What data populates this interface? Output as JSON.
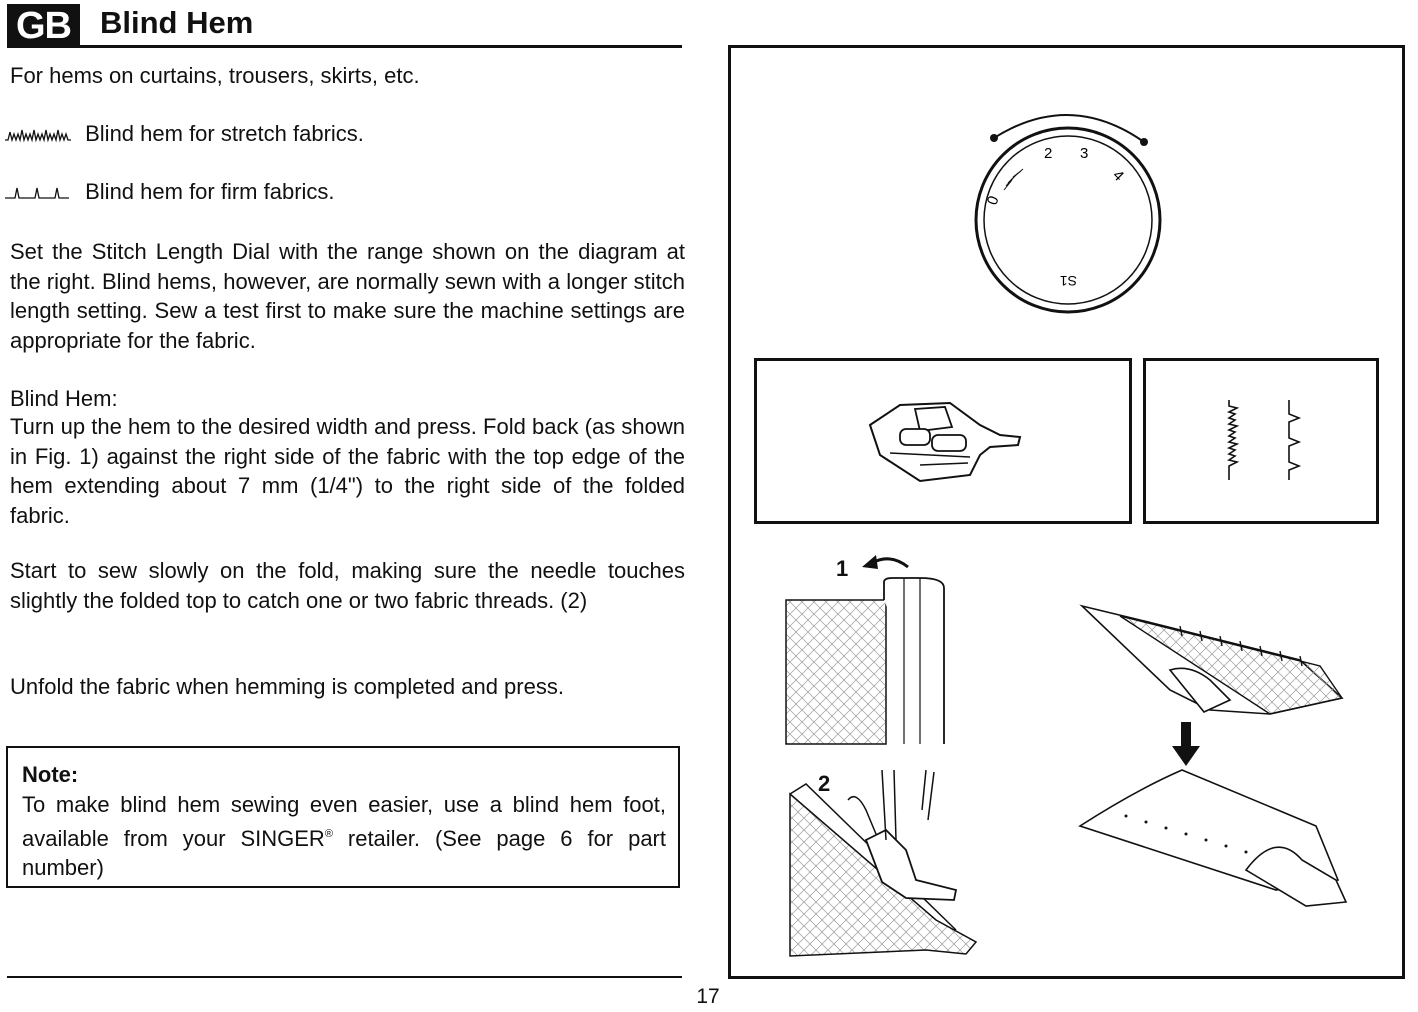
{
  "header": {
    "badge": "GB",
    "title": "Blind Hem"
  },
  "intro": "For hems on curtains, trousers, skirts, etc.",
  "stitches": [
    {
      "icon": "stretch-blind-stitch-icon",
      "label": "Blind hem for stretch fabrics."
    },
    {
      "icon": "firm-blind-stitch-icon",
      "label": "Blind hem for firm fabrics."
    }
  ],
  "paragraph_dial": "Set the Stitch Length Dial with the range shown on the diagram at the right. Blind hems, however, are normally sewn with a longer stitch length setting. Sew a test first to make sure the machine settings are appropriate for the fabric.",
  "blind_hem_heading": "Blind Hem:",
  "paragraph_fold": "Turn up the hem to the desired width and press. Fold back (as shown in Fig. 1) against the right side of the fabric with the top edge of the hem extending about 7 mm (1/4\") to the right side of the folded fabric.",
  "paragraph_sew": "Start to sew slowly on the fold, making sure the needle touches slightly the folded top to catch one or two fabric threads. (2)",
  "paragraph_unfold": "Unfold the fabric when hemming is completed and press.",
  "note": {
    "title": "Note:",
    "text_before": "To make blind hem sewing even easier, use a blind hem foot, available from your SINGER",
    "registered": "®",
    "text_after": " retailer. (See page 6 for part number)"
  },
  "figure": {
    "dial_numbers": [
      "0",
      "2",
      "3",
      "4"
    ],
    "dial_bottom_label": "S1",
    "step_labels": [
      "1",
      "2"
    ]
  },
  "page_number": "17"
}
